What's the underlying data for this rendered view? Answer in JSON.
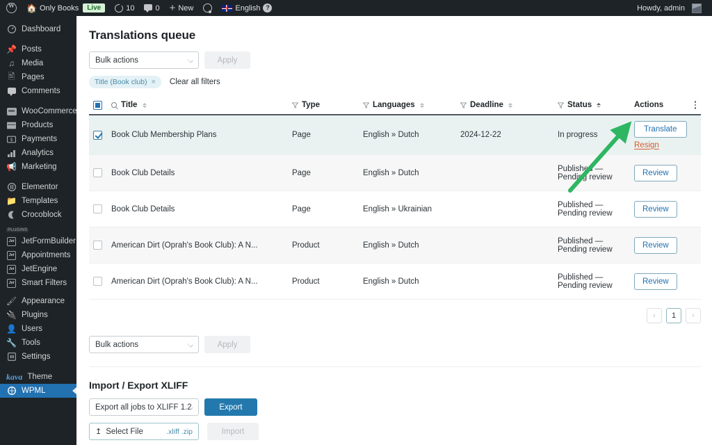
{
  "adminbar": {
    "site_name": "Only Books",
    "live_badge": "Live",
    "updates_count": "10",
    "comments_count": "0",
    "new_label": "New",
    "language": "English",
    "howdy": "Howdy, admin"
  },
  "sidebar": {
    "items": [
      {
        "label": "Dashboard",
        "icon": "dashboard-icon",
        "gap_after": true
      },
      {
        "label": "Posts",
        "icon": "pin-icon"
      },
      {
        "label": "Media",
        "icon": "media-icon"
      },
      {
        "label": "Pages",
        "icon": "pages-icon"
      },
      {
        "label": "Comments",
        "icon": "comment-icon",
        "gap_after": true
      },
      {
        "label": "WooCommerce",
        "icon": "woocommerce-icon"
      },
      {
        "label": "Products",
        "icon": "products-icon"
      },
      {
        "label": "Payments",
        "icon": "payments-icon"
      },
      {
        "label": "Analytics",
        "icon": "analytics-icon"
      },
      {
        "label": "Marketing",
        "icon": "marketing-icon",
        "gap_after": true
      },
      {
        "label": "Elementor",
        "icon": "elementor-icon"
      },
      {
        "label": "Templates",
        "icon": "templates-icon"
      },
      {
        "label": "Crocoblock",
        "icon": "crocoblock-icon"
      }
    ],
    "plugins_label": "PLUGINS",
    "plugin_items": [
      {
        "label": "JetFormBuilder",
        "icon": "jet-icon"
      },
      {
        "label": "Appointments",
        "icon": "jet-icon"
      },
      {
        "label": "JetEngine",
        "icon": "jet-icon"
      },
      {
        "label": "Smart Filters",
        "icon": "jet-icon"
      }
    ],
    "system_items": [
      {
        "label": "Appearance",
        "icon": "appearance-icon"
      },
      {
        "label": "Plugins",
        "icon": "plugins-icon"
      },
      {
        "label": "Users",
        "icon": "users-icon"
      },
      {
        "label": "Tools",
        "icon": "tools-icon"
      },
      {
        "label": "Settings",
        "icon": "settings-icon"
      }
    ],
    "theme": {
      "brand": "kava",
      "label": "Theme"
    },
    "current": {
      "label": "WPML",
      "icon": "wpml-icon"
    }
  },
  "page": {
    "title": "Translations queue"
  },
  "bulk_top": {
    "select_value": "Bulk actions",
    "apply_label": "Apply"
  },
  "filters": {
    "chip_label": "Title (Book club)",
    "chip_close": "×",
    "clear_all": "Clear all filters"
  },
  "table": {
    "columns": {
      "title": "Title",
      "type": "Type",
      "languages": "Languages",
      "deadline": "Deadline",
      "status": "Status",
      "actions": "Actions"
    },
    "rows": [
      {
        "checked": true,
        "selected": true,
        "title": "Book Club Membership Plans",
        "type": "Page",
        "languages": "English » Dutch",
        "deadline": "2024-12-22",
        "status": "In progress",
        "action_label": "Translate",
        "secondary_action": "Resign"
      },
      {
        "checked": false,
        "selected": false,
        "alt": true,
        "title": "Book Club Details",
        "type": "Page",
        "languages": "English » Dutch",
        "deadline": "",
        "status": "Published — Pending review",
        "action_label": "Review",
        "secondary_action": ""
      },
      {
        "checked": false,
        "selected": false,
        "alt": false,
        "title": "Book Club Details",
        "type": "Page",
        "languages": "English » Ukrainian",
        "deadline": "",
        "status": "Published — Pending review",
        "action_label": "Review",
        "secondary_action": ""
      },
      {
        "checked": false,
        "selected": false,
        "alt": true,
        "title": "American Dirt (Oprah's Book Club): A N...",
        "type": "Product",
        "languages": "English » Dutch",
        "deadline": "",
        "status": "Published — Pending review",
        "action_label": "Review",
        "secondary_action": ""
      },
      {
        "checked": false,
        "selected": false,
        "alt": false,
        "title": "American Dirt (Oprah's Book Club): A N...",
        "type": "Product",
        "languages": "English » Dutch",
        "deadline": "",
        "status": "Published — Pending review",
        "action_label": "Review",
        "secondary_action": ""
      }
    ]
  },
  "pagination": {
    "prev": "‹",
    "current_page": "1",
    "next": "›"
  },
  "bulk_bottom": {
    "select_value": "Bulk actions",
    "apply_label": "Apply"
  },
  "xliff": {
    "title": "Import / Export XLIFF",
    "export_select_value": "Export all jobs to XLIFF 1.2",
    "export_label": "Export",
    "file_label": "Select File",
    "file_exts": ".xliff .zip",
    "import_label": "Import"
  },
  "colors": {
    "admin_bar": "#1d2327",
    "sidebar": "#1d2327",
    "current_menu": "#2271b1",
    "selected_row": "#e9f2f1",
    "primary_button": "#2379ad",
    "resign_link": "#d9582b",
    "annotation_arrow": "#2eb662",
    "chip": "#e4f1f6"
  }
}
